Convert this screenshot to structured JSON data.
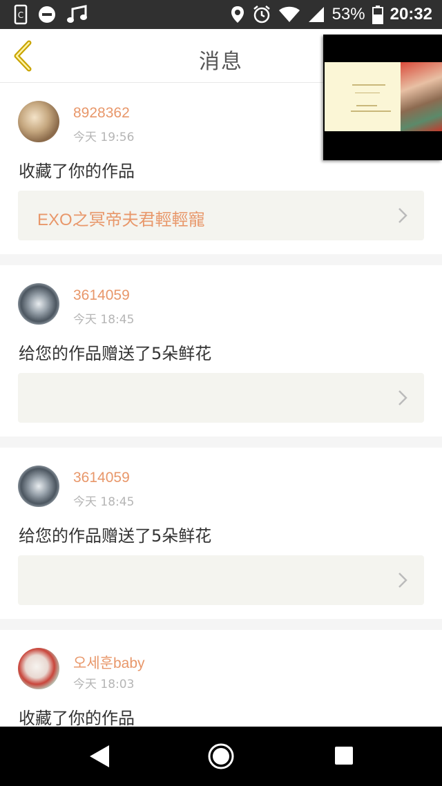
{
  "status_bar": {
    "battery_percent": "53%",
    "time": "20:32",
    "left_icons": [
      "sim-icon",
      "do-not-disturb-icon",
      "music-icon"
    ],
    "right_icons": [
      "location-icon",
      "alarm-icon",
      "wifi-icon",
      "signal-icon",
      "battery-icon"
    ]
  },
  "header": {
    "title": "消息",
    "back_icon": "chevron-left-icon"
  },
  "colors": {
    "accent": "#e8976a",
    "back_icon": "#c9a400",
    "card_link_bg": "#f4f4ef"
  },
  "messages": [
    {
      "user_name": "8928362",
      "time": "今天 19:56",
      "text": "收藏了你的作品",
      "work_title": "EXO之冥帝夫君輕輕寵"
    },
    {
      "user_name": "3614059",
      "time": "今天 18:45",
      "text": "给您的作品赠送了5朵鲜花",
      "work_title": ""
    },
    {
      "user_name": "3614059",
      "time": "今天 18:45",
      "text": "给您的作品赠送了5朵鲜花",
      "work_title": ""
    },
    {
      "user_name": "오세훈baby",
      "time": "今天 18:03",
      "text": "收藏了你的作品",
      "work_title": ""
    }
  ],
  "nav_bar": {
    "icons": [
      "back-triangle-icon",
      "home-circle-icon",
      "recents-square-icon"
    ]
  }
}
